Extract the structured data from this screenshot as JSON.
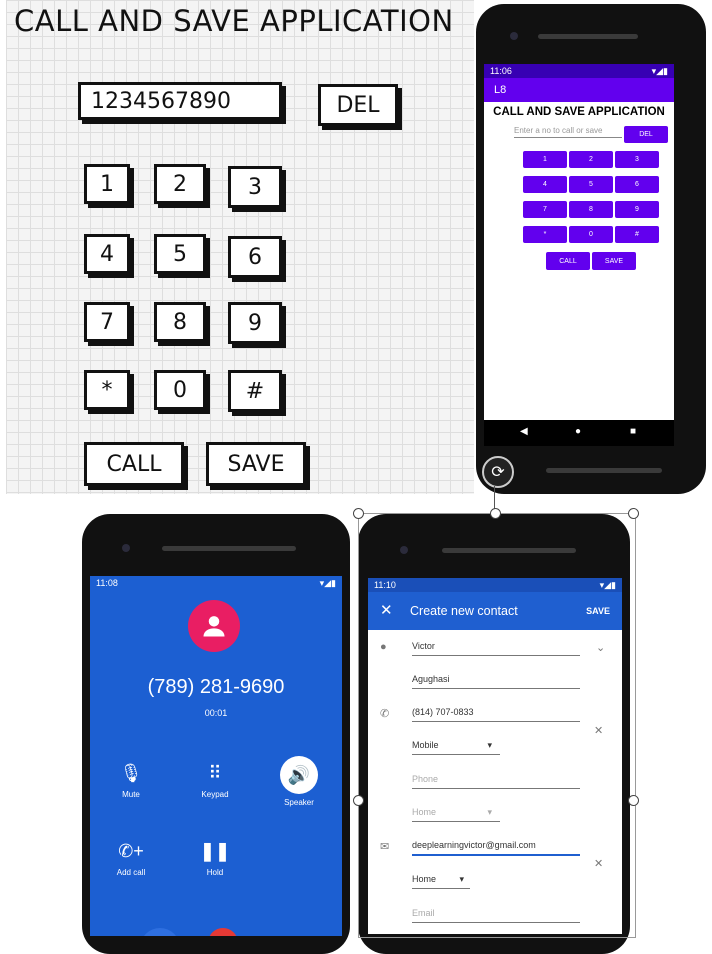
{
  "sketch": {
    "title": "CALL AND SAVE APPLICATION",
    "input_value": "1234567890",
    "del_label": "DEL",
    "keys": [
      "1",
      "2",
      "3",
      "4",
      "5",
      "6",
      "7",
      "8",
      "9",
      "*",
      "0",
      "#"
    ],
    "call_label": "CALL",
    "save_label": "SAVE"
  },
  "app": {
    "status_time": "11:06",
    "appbar_title": "L8",
    "heading": "CALL AND SAVE APPLICATION",
    "input_placeholder": "Enter a no to call or save",
    "del_label": "DEL",
    "keys": [
      "1",
      "2",
      "3",
      "4",
      "5",
      "6",
      "7",
      "8",
      "9",
      "*",
      "0",
      "#"
    ],
    "call_label": "CALL",
    "save_label": "SAVE",
    "nav": {
      "back_icon": "◀",
      "home_icon": "●",
      "recents_icon": "■"
    }
  },
  "dialer": {
    "status_time": "11:08",
    "number": "(789) 281-9690",
    "timer": "00:01",
    "actions": [
      {
        "label": "Mute",
        "icon": "mute-icon"
      },
      {
        "label": "Keypad",
        "icon": "keypad-icon"
      },
      {
        "label": "Speaker",
        "icon": "speaker-icon"
      },
      {
        "label": "Add call",
        "icon": "add-call-icon"
      },
      {
        "label": "Hold",
        "icon": "hold-icon"
      }
    ]
  },
  "contact": {
    "status_time": "11:10",
    "title": "Create new contact",
    "save_label": "SAVE",
    "first_name": "Victor",
    "last_name": "Agughasi",
    "phone": "(814) 707-0833",
    "phone_type": "Mobile",
    "phone_placeholder": "Phone",
    "phone_type2": "Home",
    "email": "deeplearningvictor@gmail.com",
    "email_type": "Home",
    "email_placeholder": "Email"
  }
}
